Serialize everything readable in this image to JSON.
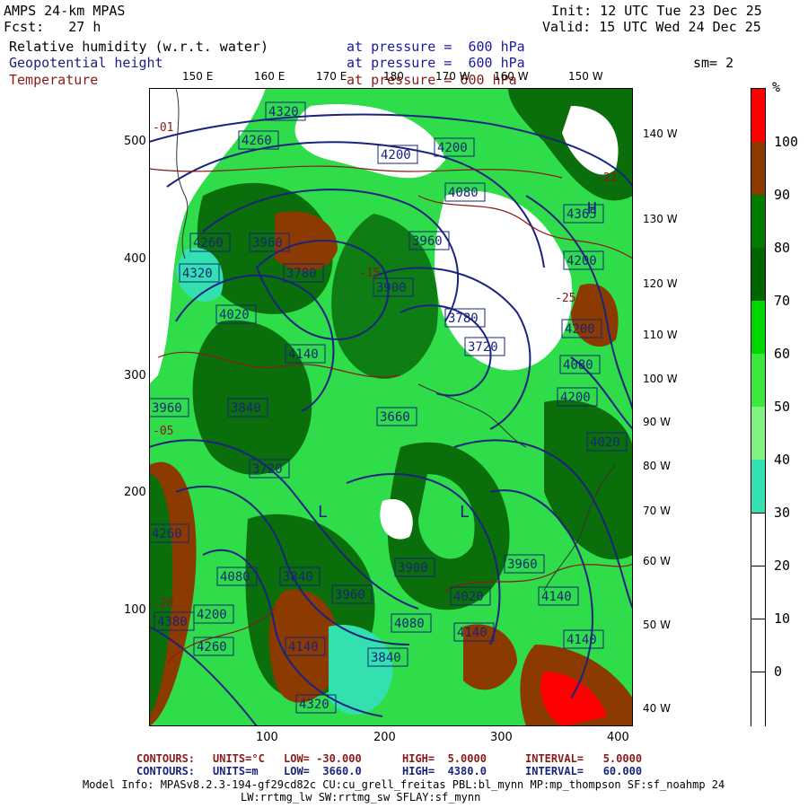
{
  "header": {
    "model": "AMPS 24-km MPAS",
    "fcst": "Fcst:   27 h",
    "init": "Init: 12 UTC Tue 23 Dec 25",
    "valid": "Valid: 15 UTC Wed 24 Dec 25"
  },
  "fields": {
    "rh_name": "Relative humidity (w.r.t. water)",
    "rh_level": "at pressure =  600 hPa",
    "gz_name": "Geopotential height",
    "gz_level": "at pressure =  600 hPa",
    "t_name": "Temperature",
    "t_level": "at pressure = 600 hPa",
    "smooth": "sm= 2"
  },
  "colorbar": {
    "unit": "%",
    "levels": [
      "100",
      "90",
      "80",
      "70",
      "60",
      "50",
      "40",
      "30",
      "20",
      "10",
      "0"
    ],
    "colors": [
      "#ff0000",
      "#8b3a00",
      "#007a00",
      "#006400",
      "#00d700",
      "#3ce83c",
      "#82f082",
      "#33e0b0",
      "#ffffff",
      "#ffffff",
      "#ffffff",
      "#ffffff"
    ]
  },
  "axes": {
    "y_ticks": [
      "500",
      "400",
      "300",
      "200",
      "100"
    ],
    "x_ticks": [
      "100",
      "200",
      "300",
      "400"
    ],
    "top_lon": [
      "150 E",
      "160 E",
      "170 E",
      "180",
      "170 W",
      "160 W",
      "150 W"
    ],
    "right_lon": [
      "140 W",
      "130 W",
      "120 W",
      "110 W",
      "100 W",
      "90 W",
      "80 W",
      "70 W",
      "60 W",
      "50 W",
      "40 W"
    ]
  },
  "contour_labels": {
    "heights": [
      "4320",
      "4260",
      "4200",
      "4200",
      "4080",
      "3960",
      "4260",
      "4260",
      "4320",
      "3960",
      "3960",
      "3780",
      "4020",
      "4200",
      "3780",
      "3900",
      "3840",
      "3720",
      "4140",
      "3960",
      "3840",
      "3720",
      "4080",
      "3960",
      "4260",
      "4200",
      "4140",
      "4080",
      "4020",
      "4140",
      "4080",
      "4140",
      "4200",
      "4320",
      "3900",
      "3660",
      "4380",
      "4260",
      "4140",
      "4320",
      "4080",
      "3840",
      "4020",
      "3960",
      "4140",
      "4200",
      "4320",
      "4380",
      "4200",
      "4140",
      "4365",
      "3900",
      "4080",
      "3780",
      "4140"
    ],
    "temperature_marks": [
      "-01",
      "-05",
      "-20",
      "-15",
      "-25",
      "-22"
    ],
    "highs": [
      "H"
    ],
    "lows": [
      "L",
      "L"
    ]
  },
  "footer": {
    "line1_label": "CONTOURS:",
    "line1_units": "UNITS=°C",
    "line1_low": "LOW= -30.000",
    "line1_high": "HIGH=  5.0000",
    "line1_interval": "INTERVAL=   5.0000",
    "line2_label": "CONTOURS:",
    "line2_units": "UNITS=m",
    "line2_low": "LOW=  3660.0",
    "line2_high": "HIGH=  4380.0",
    "line2_interval": "INTERVAL=   60.000",
    "model_info": "Model Info: MPASv8.2.3-194-gf29cd82c CU:cu_grell_freitas PBL:bl_mynn MP:mp_thompson SF:sf_noahmp 24",
    "model_info2": "LW:rrtmg_lw SW:rrtmg_sw SFLAY:sf_mynn"
  }
}
